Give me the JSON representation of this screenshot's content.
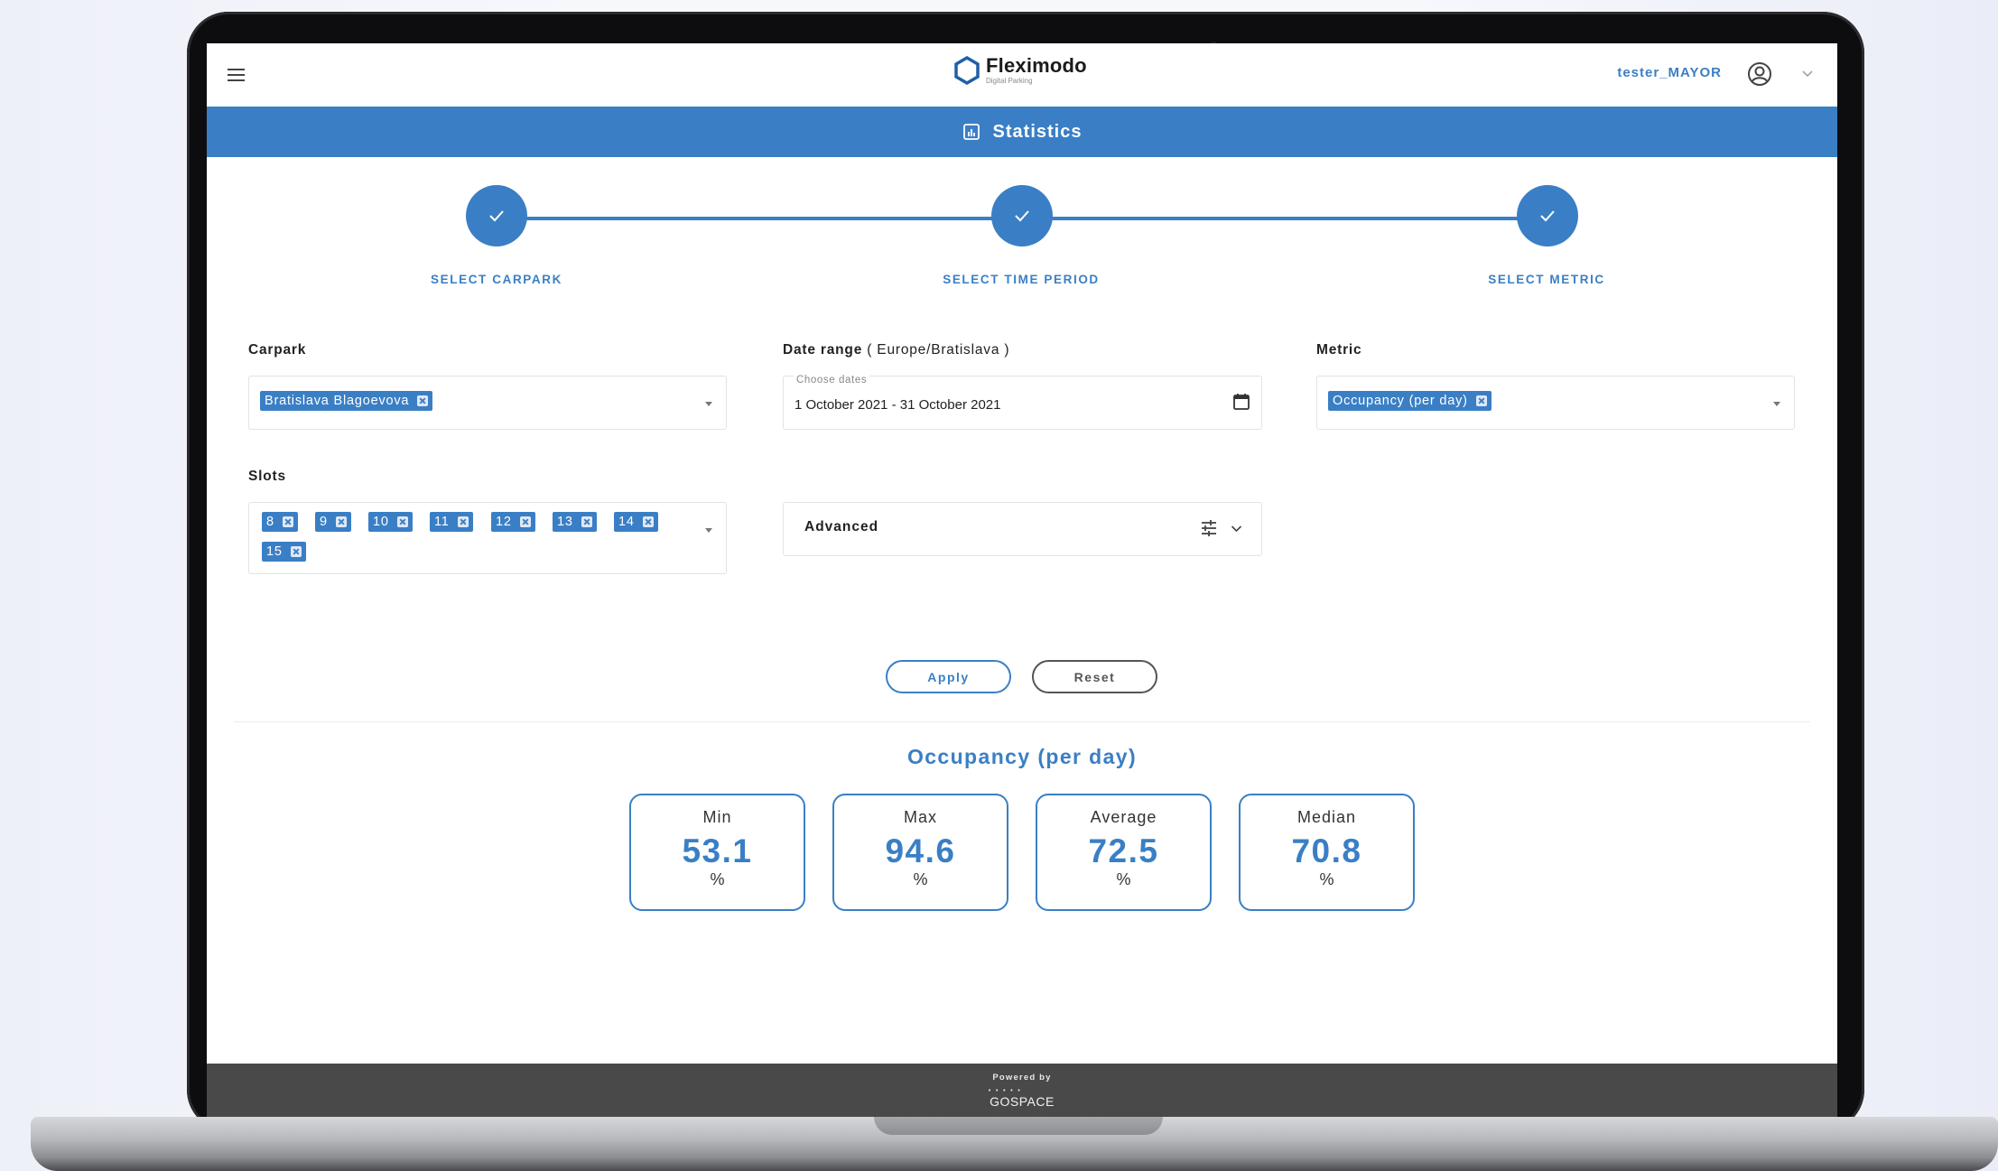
{
  "app": {
    "brand_name": "Fleximodo",
    "brand_tagline": "Digital Parking",
    "username": "tester_MAYOR"
  },
  "page": {
    "title": "Statistics"
  },
  "stepper": {
    "steps": [
      {
        "label": "SELECT CARPARK",
        "completed": true
      },
      {
        "label": "SELECT TIME PERIOD",
        "completed": true
      },
      {
        "label": "SELECT METRIC",
        "completed": true
      }
    ]
  },
  "form": {
    "carpark": {
      "label": "Carpark",
      "selected": "Bratislava Blagoevova"
    },
    "date_range": {
      "label": "Date range",
      "timezone": "( Europe/Bratislava )",
      "placeholder": "Choose dates",
      "value": "1 October 2021 - 31 October 2021"
    },
    "metric": {
      "label": "Metric",
      "selected": "Occupancy (per day)"
    },
    "slots": {
      "label": "Slots",
      "selected": [
        "8",
        "9",
        "10",
        "11",
        "12",
        "13",
        "14",
        "15"
      ]
    },
    "advanced": {
      "label": "Advanced"
    }
  },
  "actions": {
    "apply_label": "Apply",
    "reset_label": "Reset"
  },
  "results": {
    "title": "Occupancy (per day)",
    "stats": [
      {
        "label": "Min",
        "value": "53.1",
        "unit": "%"
      },
      {
        "label": "Max",
        "value": "94.6",
        "unit": "%"
      },
      {
        "label": "Average",
        "value": "72.5",
        "unit": "%"
      },
      {
        "label": "Median",
        "value": "70.8",
        "unit": "%"
      }
    ]
  },
  "footer": {
    "powered_by": "Powered by",
    "provider": "GOSPACE"
  },
  "colors": {
    "accent": "#3a7fc5",
    "footer_bg": "#494949"
  }
}
